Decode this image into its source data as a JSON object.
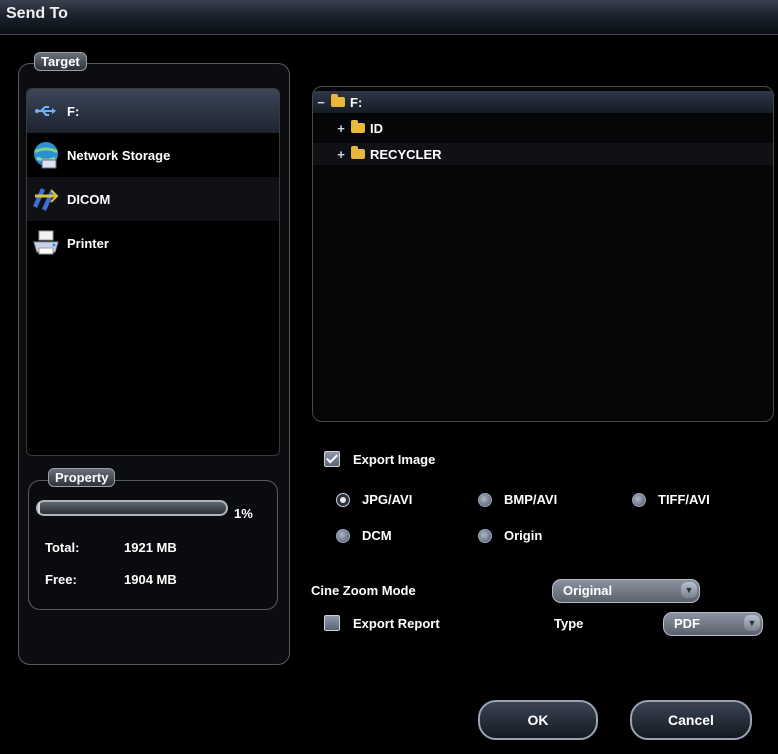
{
  "window": {
    "title": "Send To"
  },
  "target": {
    "label": "Target",
    "items": [
      {
        "label": "F:",
        "icon": "usb-icon",
        "selected": true
      },
      {
        "label": "Network Storage",
        "icon": "network-globe-icon",
        "selected": false
      },
      {
        "label": "DICOM",
        "icon": "dicom-icon",
        "selected": false
      },
      {
        "label": "Printer",
        "icon": "printer-icon",
        "selected": false
      }
    ]
  },
  "tree": {
    "root": {
      "label": "F:",
      "expander": "−"
    },
    "children": [
      {
        "label": "ID",
        "expander": "+"
      },
      {
        "label": "RECYCLER",
        "expander": "+"
      }
    ]
  },
  "property": {
    "label": "Property",
    "usage_percent": 1,
    "usage_text": "1%",
    "total_label": "Total:",
    "total_value": "1921 MB",
    "free_label": "Free:",
    "free_value": "1904 MB"
  },
  "options": {
    "export_image": {
      "label": "Export Image",
      "checked": true
    },
    "formats": [
      {
        "label": "JPG/AVI",
        "selected": true
      },
      {
        "label": "BMP/AVI",
        "selected": false
      },
      {
        "label": "TIFF/AVI",
        "selected": false
      },
      {
        "label": "DCM",
        "selected": false
      },
      {
        "label": "Origin",
        "selected": false
      }
    ],
    "cine_zoom": {
      "label": "Cine Zoom Mode",
      "value": "Original"
    },
    "export_report": {
      "label": "Export Report",
      "checked": false
    },
    "type": {
      "label": "Type",
      "value": "PDF"
    }
  },
  "buttons": {
    "ok": "OK",
    "cancel": "Cancel"
  },
  "colors": {
    "background": "#000000",
    "accent": "#3c4658",
    "text": "#ffffff"
  }
}
